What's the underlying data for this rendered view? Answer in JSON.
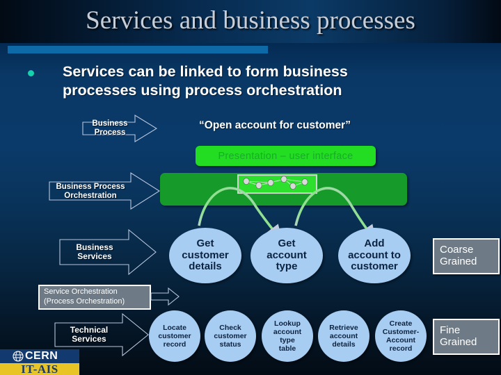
{
  "slide": {
    "title": "Services and business processes",
    "accent_color": "#0d6aa6",
    "background_top": "#020a14",
    "background_body": "#0a3866",
    "background_bottom": "#030c15"
  },
  "bullet": {
    "marker": "bullet-dot",
    "text": "Services can be linked to form business processes using process orchestration"
  },
  "quote": {
    "text": "“Open account for customer”"
  },
  "arrows": [
    {
      "id": "business-process",
      "label": "Business Process"
    },
    {
      "id": "business-process-orchestration",
      "label": "Business Process\nOrchestration"
    },
    {
      "id": "business-services",
      "label": "Business\nServices"
    },
    {
      "id": "technical-services",
      "label": "Technical\nServices"
    }
  ],
  "arrow_labels": {
    "business_process": "Business Process",
    "bpo_line1": "Business Process",
    "bpo_line2": "Orchestration",
    "business_services_line1": "Business",
    "business_services_line2": "Services",
    "technical_services_line1": "Technical",
    "technical_services_line2": "Services"
  },
  "presentation": {
    "label": "Presentation – user interface",
    "fill": "#22dd22",
    "text_color": "#1aab2a"
  },
  "orchestration": {
    "fill": "#169a2a",
    "inner_fill": "#2ee02e",
    "node_count": 7
  },
  "service_orchestration_label": {
    "line1": "Service Orchestration",
    "line2": "(Process Orchestration)"
  },
  "business_services_ovals": [
    {
      "id": "get-customer-details",
      "line1": "Get",
      "line2": "customer",
      "line3": "details"
    },
    {
      "id": "get-account-type",
      "line1": "Get",
      "line2": "account",
      "line3": "type"
    },
    {
      "id": "add-account-to-customer",
      "line1": "Add",
      "line2": "account to",
      "line3": "customer"
    }
  ],
  "technical_services_ovals": [
    {
      "id": "locate-customer-record",
      "line1": "Locate",
      "line2": "customer",
      "line3": "record",
      "line4": ""
    },
    {
      "id": "check-customer-status",
      "line1": "Check",
      "line2": "customer",
      "line3": "status",
      "line4": ""
    },
    {
      "id": "lookup-account-type-table",
      "line1": "Lookup",
      "line2": "account",
      "line3": "type",
      "line4": "table"
    },
    {
      "id": "retrieve-account-details",
      "line1": "Retrieve",
      "line2": "account",
      "line3": "details",
      "line4": ""
    },
    {
      "id": "create-customer-account-record",
      "line1": "Create",
      "line2": "Customer-",
      "line3": "Account",
      "line4": "record"
    }
  ],
  "grain_boxes": {
    "coarse_line1": "Coarse",
    "coarse_line2": "Grained",
    "fine_line1": "Fine",
    "fine_line2": "Grained",
    "fill": "#6e7b86",
    "border": "#ffffff"
  },
  "footer_logo": {
    "org": "CERN",
    "department": "IT-AIS",
    "band_color": "#133a6e",
    "accent_color": "#e8c524"
  }
}
